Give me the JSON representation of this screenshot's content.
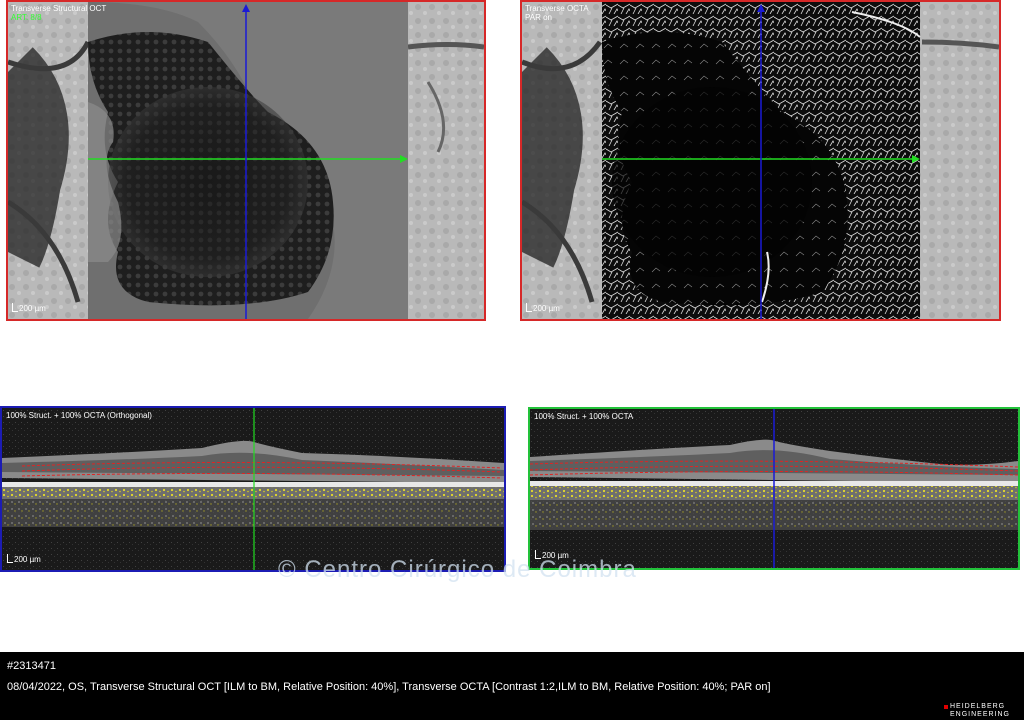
{
  "panels": {
    "structural": {
      "title": "Transverse Structural OCT",
      "subtitle": "ART: 8/8",
      "scale": "200 µm"
    },
    "octa": {
      "title": "Transverse OCTA",
      "subtitle": "PAR on",
      "scale": "200 µm"
    },
    "bscan_orthogonal": {
      "title": "100% Struct. + 100% OCTA (Orthogonal)",
      "scale": "200 µm"
    },
    "bscan": {
      "title": "100% Struct. + 100% OCTA",
      "scale": "200 µm"
    }
  },
  "watermark": "© Centro Cirúrgico de Coimbra",
  "footer": {
    "id": "#2313471",
    "description": "08/04/2022, OS, Transverse Structural OCT [ILM to BM, Relative Position: 40%], Transverse OCTA [Contrast 1:2,ILM to BM, Relative Position: 40%; PAR on]",
    "logo_line1": "HEIDELBERG",
    "logo_line2": "ENGINEERING"
  },
  "colors": {
    "frame_red": "#d62828",
    "frame_blue": "#1c1cb4",
    "frame_green": "#22c23a",
    "crosshair_green": "#22dd22",
    "crosshair_blue": "#1a1ad6",
    "segmentation_red": "#e02424",
    "exudate_yellow": "#e6dd2a"
  },
  "icons": [
    "scale-bar-icon",
    "crosshair-horizontal-arrow-icon",
    "crosshair-vertical-arrow-icon"
  ]
}
